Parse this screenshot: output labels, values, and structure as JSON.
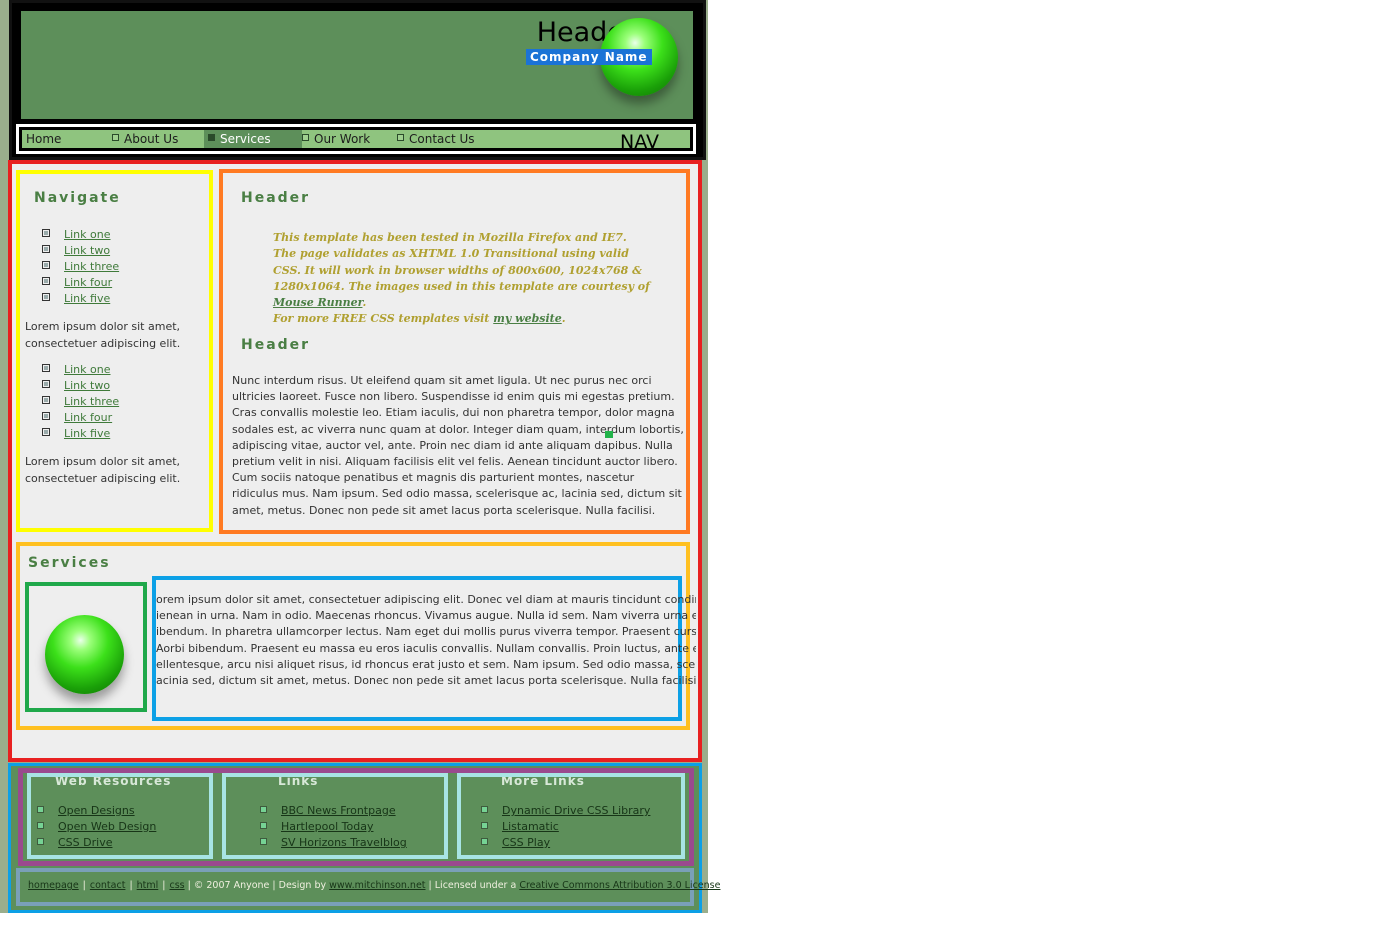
{
  "header": {
    "title": "Header",
    "company_name": "Company Name"
  },
  "nav": {
    "label": "NAV",
    "items": [
      {
        "label": "Home"
      },
      {
        "label": "About Us"
      },
      {
        "label": "Services"
      },
      {
        "label": "Our Work"
      },
      {
        "label": "Contact Us"
      }
    ],
    "active": "Services"
  },
  "sidebar": {
    "heading": "Navigate",
    "list1": [
      "Link one",
      "Link two",
      "Link three",
      "Link four",
      "Link five"
    ],
    "text1": "Lorem ipsum dolor sit amet, consectetuer adipiscing elit.",
    "list2": [
      "Link one",
      "Link two",
      "Link three",
      "Link four",
      "Link five"
    ],
    "text2": "Lorem ipsum dolor sit amet, consectetuer adipiscing elit."
  },
  "content": {
    "heading1": "Header",
    "intro_part1": "This template has been tested in Mozilla Firefox and IE7. The page validates as XHTML 1.0 Transitional using valid CSS. It will work in browser widths of 800x600, 1024x768 & 1280x1064. The images used in this template are courtesy of ",
    "intro_link1": "Mouse Runner",
    "intro_part2": ".",
    "intro_part3": "For more FREE CSS templates visit ",
    "intro_link2": "my website",
    "intro_part4": ".",
    "heading2": "Header",
    "body": "Nunc interdum risus. Ut eleifend quam sit amet ligula. Ut nec purus nec orci ultricies laoreet. Fusce non libero. Suspendisse id enim quis mi egestas pretium. Cras convallis molestie leo. Etiam iaculis, dui non pharetra tempor, dolor magna sodales est, ac viverra nunc quam at dolor. Integer diam quam, interdum lobortis, adipiscing vitae, auctor vel, ante. Proin nec diam id ante aliquam dapibus. Nulla pretium velit in nisi. Aliquam facilisis elit vel felis. Aenean tincidunt auctor libero. Cum sociis natoque penatibus et magnis dis parturient montes, nascetur ridiculus mus. Nam ipsum. Sed odio massa, scelerisque ac, lacinia sed, dictum sit amet, metus. Donec non pede sit amet lacus porta scelerisque. Nulla facilisi."
  },
  "services": {
    "heading": "Services",
    "lines": [
      "orem ipsum dolor sit amet, consectetuer adipiscing elit. Donec vel diam at mauris tincidunt condimentum.",
      "ienean in urna. Nam in odio. Maecenas rhoncus. Vivamus augue. Nulla id sem. Nam viverra urna et nisl tincidunt",
      "ibendum. In pharetra ullamcorper lectus. Nam eget dui mollis purus viverra tempor. Praesent cursus nunc ac ur.",
      "Aorbi bibendum. Praesent eu massa eu eros iaculis convallis. Nullam convallis. Proin luctus, ante eget molestie",
      "ellentesque, arcu nisi aliquet risus, id rhoncus erat justo et sem. Nam ipsum. Sed odio massa, scelerisque ac,",
      "acinia sed, dictum sit amet, metus. Donec non pede sit amet lacus porta scelerisque. Nulla facilisi."
    ]
  },
  "footer": {
    "columns": [
      {
        "heading": "Web Resources",
        "links": [
          "Open Designs",
          "Open Web Design",
          "CSS Drive"
        ]
      },
      {
        "heading": "Links",
        "links": [
          "BBC News Frontpage",
          "Hartlepool Today",
          "SV Horizons Travelblog"
        ]
      },
      {
        "heading": "More Links",
        "links": [
          "Dynamic Drive CSS Library",
          "Listamatic",
          "CSS Play"
        ]
      }
    ],
    "bottom": {
      "links": [
        "homepage",
        "contact",
        "html",
        "css"
      ],
      "copyright": "| © 2007 Anyone | Design by ",
      "designer_link": "www.mitchinson.net",
      "license_text": " | Licensed under a ",
      "license_link": "Creative Commons Attribution 3.0 License"
    }
  }
}
